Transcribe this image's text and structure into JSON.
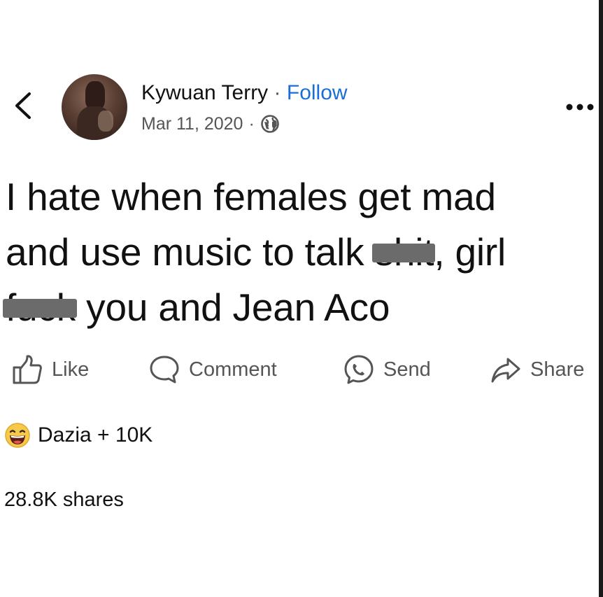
{
  "post": {
    "author": "Kywuan Terry",
    "separator": "·",
    "follow_label": "Follow",
    "date": "Mar 11, 2020",
    "meta_separator": "·",
    "privacy_icon": "globe-icon",
    "text_lines": [
      {
        "before": "I hate when females get mad",
        "censored": "",
        "after": ""
      },
      {
        "before": "and use music to talk ",
        "censored": "shit",
        "after": ", girl"
      },
      {
        "before": "",
        "censored": "fuck",
        "after": " you and Jean Aco"
      }
    ]
  },
  "actions": {
    "like_label": "Like",
    "comment_label": "Comment",
    "send_label": "Send",
    "share_label": "Share"
  },
  "reactions": {
    "emoji": "laughing-face-emoji",
    "summary": "Dazia + 10K"
  },
  "shares": {
    "label": "28.8K shares"
  },
  "colors": {
    "link": "#1a6fd6",
    "text": "#111111",
    "secondary": "#555555",
    "emoji_face": "#f7c94b"
  }
}
